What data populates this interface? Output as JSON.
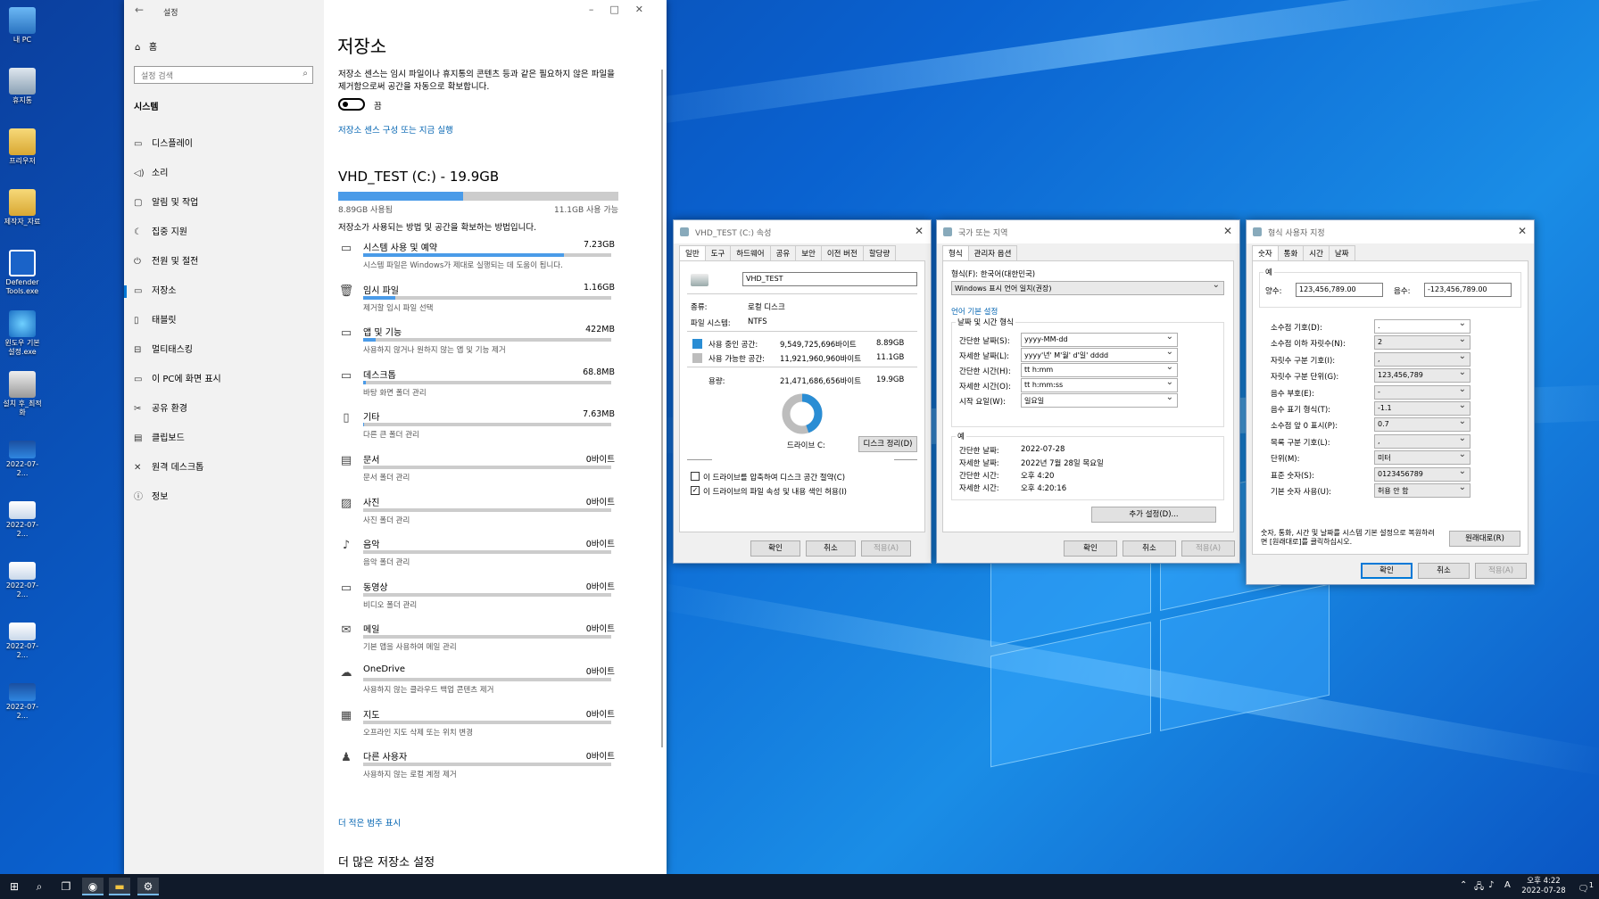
{
  "desktop": {
    "icons": [
      "내 PC",
      "휴지통",
      "프리우저",
      "제작자_자료",
      "Defender Tools.exe",
      "윈도우 기본 설정.exe",
      "설치 후_최적화",
      "2022-07-2...",
      "2022-07-2...",
      "2022-07-2...",
      "2022-07-2...",
      "2022-07-2..."
    ]
  },
  "settings": {
    "title": "설정",
    "home": "홈",
    "search_placeholder": "설정 검색",
    "category": "시스템",
    "nav": [
      "디스플레이",
      "소리",
      "알림 및 작업",
      "집중 지원",
      "전원 및 절전",
      "저장소",
      "태블릿",
      "멀티태스킹",
      "이 PC에 화면 표시",
      "공유 환경",
      "클립보드",
      "원격 데스크톱",
      "정보"
    ],
    "page_title": "저장소",
    "sense_desc": "저장소 센스는 임시 파일이나 휴지통의 콘텐츠 등과 같은 필요하지 않은 파일을 제거함으로써 공간을 자동으로 확보합니다.",
    "toggle_label": "끔",
    "sense_link": "저장소 센스 구성 또는 지금 실행",
    "drive_title": "VHD_TEST (C:) - 19.9GB",
    "used": "8.89GB 사용됨",
    "free": "11.1GB 사용 가능",
    "used_fraction": 0.447,
    "intro": "저장소가 사용되는 방법 및 공간을 확보하는 방법입니다.",
    "categories": [
      {
        "name": "시스템 사용 및 예약",
        "size": "7.23GB",
        "desc": "시스템 파일은 Windows가 제대로 실행되는 데 도움이 됩니다.",
        "fill": 0.81
      },
      {
        "name": "임시 파일",
        "size": "1.16GB",
        "desc": "제거할 임시 파일 선택",
        "fill": 0.13
      },
      {
        "name": "앱 및 기능",
        "size": "422MB",
        "desc": "사용하지 않거나 원하지 않는 앱 및 기능 제거",
        "fill": 0.05
      },
      {
        "name": "데스크톱",
        "size": "68.8MB",
        "desc": "바탕 화면 폴더 관리",
        "fill": 0.01
      },
      {
        "name": "기타",
        "size": "7.63MB",
        "desc": "다른 큰 폴더 관리",
        "fill": 0.005
      },
      {
        "name": "문서",
        "size": "0바이트",
        "desc": "문서 폴더 관리",
        "fill": 0
      },
      {
        "name": "사진",
        "size": "0바이트",
        "desc": "사진 폴더 관리",
        "fill": 0
      },
      {
        "name": "음악",
        "size": "0바이트",
        "desc": "음악 폴더 관리",
        "fill": 0
      },
      {
        "name": "동영상",
        "size": "0바이트",
        "desc": "비디오 폴더 관리",
        "fill": 0
      },
      {
        "name": "메일",
        "size": "0바이트",
        "desc": "기본 앱을 사용하여 메일 관리",
        "fill": 0
      },
      {
        "name": "OneDrive",
        "size": "0바이트",
        "desc": "사용하지 않는 클라우드 백업 콘텐츠 제거",
        "fill": 0
      },
      {
        "name": "지도",
        "size": "0바이트",
        "desc": "오프라인 지도 삭제 또는 위치 변경",
        "fill": 0
      },
      {
        "name": "다른 사용자",
        "size": "0바이트",
        "desc": "사용하지 않는 로컬 계정 제거",
        "fill": 0
      }
    ],
    "more_link": "더 적은 범주 표시",
    "more_heading": "더 많은 저장소 설정"
  },
  "props": {
    "title": "VHD_TEST (C:) 속성",
    "tabs": [
      "일반",
      "도구",
      "하드웨어",
      "공유",
      "보안",
      "이전 버전",
      "할당량"
    ],
    "name": "VHD_TEST",
    "type_label": "종류:",
    "type_value": "로컬 디스크",
    "fs_label": "파일 시스템:",
    "fs_value": "NTFS",
    "used_label": "사용 중인 공간:",
    "used_bytes": "9,549,725,696바이트",
    "used_gb": "8.89GB",
    "free_label": "사용 가능한 공간:",
    "free_bytes": "11,921,960,960바이트",
    "free_gb": "11.1GB",
    "cap_label": "용량:",
    "cap_bytes": "21,471,686,656바이트",
    "cap_gb": "19.9GB",
    "drive_label": "드라이브 C:",
    "cleanup": "디스크 정리(D)",
    "compress": "이 드라이브를 압축하여 디스크 공간 절약(C)",
    "index": "이 드라이브의 파일 속성 및 내용 색인 허용(I)",
    "ok": "확인",
    "cancel": "취소",
    "apply": "적용(A)",
    "used_color": "#2a8dd4",
    "free_color": "#bdbdbd"
  },
  "region": {
    "title": "국가 또는 지역",
    "tabs": [
      "형식",
      "관리자 옵션"
    ],
    "format_label": "형식(F): 한국어(대한민국)",
    "format_value": "Windows 표시 언어 일치(권장)",
    "lang_link": "언어 기본 설정",
    "group_title": "날짜 및 시간 형식",
    "rows": [
      {
        "label": "간단한 날짜(S):",
        "value": "yyyy-MM-dd"
      },
      {
        "label": "자세한 날짜(L):",
        "value": "yyyy'년' M'월' d'일' dddd"
      },
      {
        "label": "간단한 시간(H):",
        "value": "tt h:mm"
      },
      {
        "label": "자세한 시간(O):",
        "value": "tt h:mm:ss"
      },
      {
        "label": "시작 요일(W):",
        "value": "일요일"
      }
    ],
    "example_title": "예",
    "examples": [
      {
        "label": "간단한 날짜:",
        "value": "2022-07-28"
      },
      {
        "label": "자세한 날짜:",
        "value": "2022년 7월 28일 목요일"
      },
      {
        "label": "간단한 시간:",
        "value": "오후 4:20"
      },
      {
        "label": "자세한 시간:",
        "value": "오후 4:20:16"
      }
    ],
    "more": "추가 설정(D)...",
    "ok": "확인",
    "cancel": "취소",
    "apply": "적용(A)"
  },
  "custom": {
    "title": "형식 사용자 지정",
    "tabs": [
      "숫자",
      "통화",
      "시간",
      "날짜"
    ],
    "example_title": "예",
    "pos_label": "양수:",
    "pos_value": "123,456,789.00",
    "neg_label": "음수:",
    "neg_value": "-123,456,789.00",
    "rows": [
      {
        "label": "소수점 기호(D):",
        "value": "."
      },
      {
        "label": "소수점 이하 자릿수(N):",
        "value": "2"
      },
      {
        "label": "자릿수 구분 기호(I):",
        "value": ","
      },
      {
        "label": "자릿수 구분 단위(G):",
        "value": "123,456,789"
      },
      {
        "label": "음수 부호(E):",
        "value": "-"
      },
      {
        "label": "음수 표기 형식(T):",
        "value": "-1.1"
      },
      {
        "label": "소수점 앞 0 표시(P):",
        "value": "0.7"
      },
      {
        "label": "목록 구분 기호(L):",
        "value": ","
      },
      {
        "label": "단위(M):",
        "value": "미터"
      },
      {
        "label": "표준 숫자(S):",
        "value": "0123456789"
      },
      {
        "label": "기본 숫자 사용(U):",
        "value": "허용 안 함"
      }
    ],
    "reset_text": "숫자, 통화, 시간 및 날짜를 시스템 기본 설정으로 복원하려면 [원래대로]를 클릭하십시오.",
    "reset": "원래대로(R)",
    "ok": "확인",
    "cancel": "취소",
    "apply": "적용(A)"
  },
  "taskbar": {
    "time": "오후 4:22",
    "date": "2022-07-28",
    "ime": "A",
    "notif": "1"
  }
}
